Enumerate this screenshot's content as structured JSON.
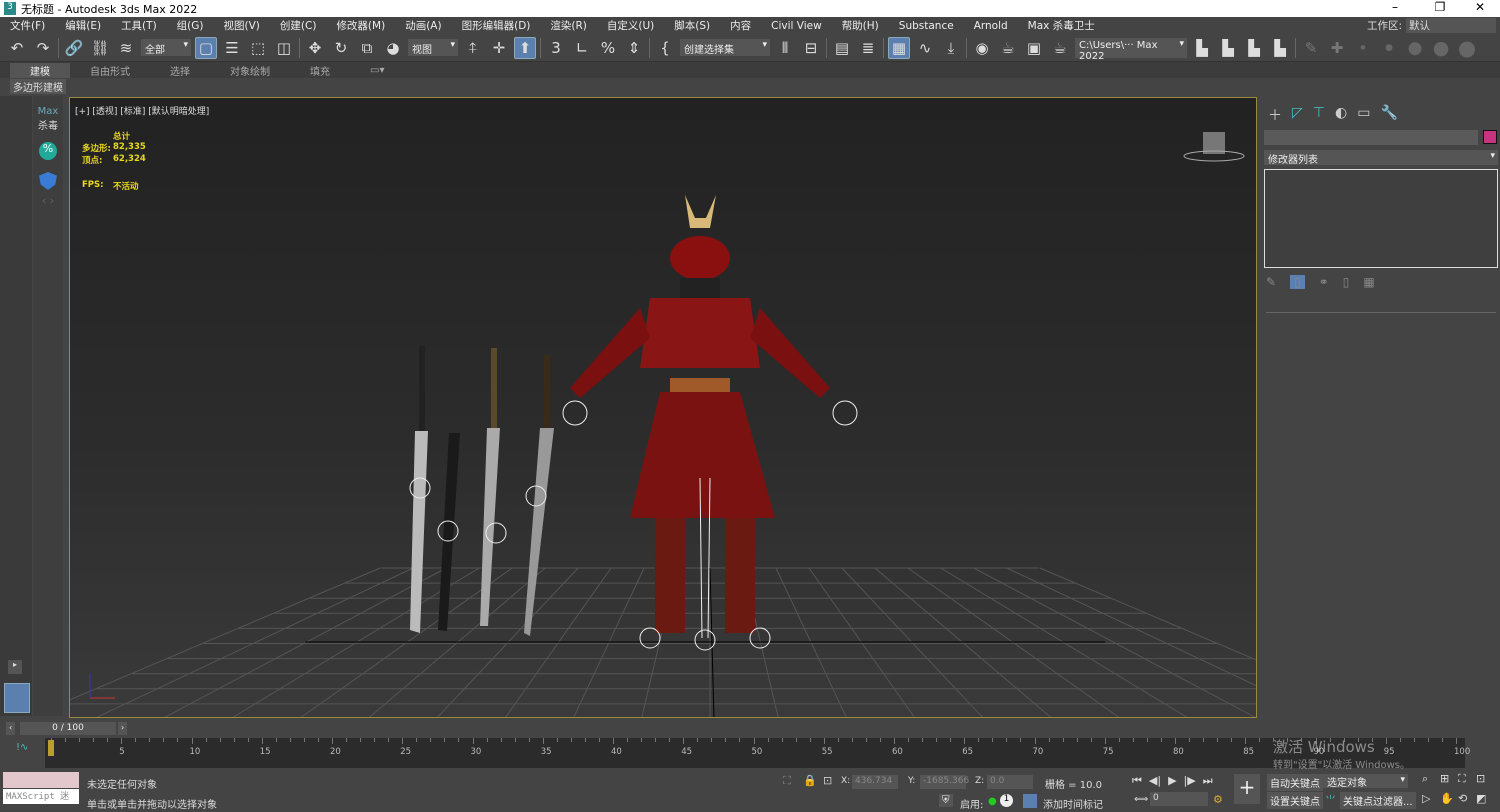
{
  "window": {
    "title": "无标题 - Autodesk 3ds Max 2022",
    "controls": [
      "–",
      "❐",
      "✕"
    ]
  },
  "menu": {
    "items": [
      "文件(F)",
      "编辑(E)",
      "工具(T)",
      "组(G)",
      "视图(V)",
      "创建(C)",
      "修改器(M)",
      "动画(A)",
      "图形编辑器(D)",
      "渲染(R)",
      "自定义(U)",
      "脚本(S)",
      "内容",
      "Civil View",
      "帮助(H)",
      "Substance",
      "Arnold",
      "Max 杀毒卫士"
    ],
    "workspace_label": "工作区:",
    "workspace_value": "默认"
  },
  "toolbar": {
    "selection_filter": "全部",
    "ref_coord": "视图",
    "named_selection": "创建选择集",
    "project_path": "C:\\Users\\··· Max 2022"
  },
  "ribbon": {
    "tabs": [
      "建模",
      "自由形式",
      "选择",
      "对象绘制",
      "填充"
    ],
    "active": "建模",
    "sub_label": "多边形建模"
  },
  "left_panel": {
    "plugin_label_1": "Max",
    "plugin_label_2": "杀毒"
  },
  "viewport": {
    "labels": "[+] [透视] [标准] [默认明暗处理]",
    "stats_title": "总计",
    "polys_label": "多边形:",
    "polys": "82,335",
    "verts_label": "顶点:",
    "verts": "62,324",
    "fps_label": "FPS:",
    "fps": "不活动"
  },
  "command_panel": {
    "modifier_list": "修改器列表",
    "object_color": "#c8337f"
  },
  "timeline": {
    "frame_display": "0 / 100",
    "ticks": [
      "0",
      "5",
      "10",
      "15",
      "20",
      "25",
      "30",
      "35",
      "40",
      "45",
      "50",
      "55",
      "60",
      "65",
      "70",
      "75",
      "80",
      "85",
      "90",
      "95",
      "100"
    ]
  },
  "status": {
    "maxscript": "MAXScript 迷",
    "line1": "未选定任何对象",
    "line2": "单击或单击并拖动以选择对象",
    "x_label": "X:",
    "x": "436.734",
    "y_label": "Y:",
    "y": "-1685.366",
    "z_label": "Z:",
    "z": "0.0",
    "grid": "栅格 = 10.0",
    "enable_label": "启用:",
    "add_time_tag": "添加时间标记",
    "frame": "0",
    "auto_key": "自动关键点",
    "set_key": "设置关键点",
    "selected_obj": "选定对象",
    "key_filters": "关键点过滤器...",
    "watermark_1": "激活 Windows",
    "watermark_2": "转到\"设置\"以激活 Windows。"
  }
}
